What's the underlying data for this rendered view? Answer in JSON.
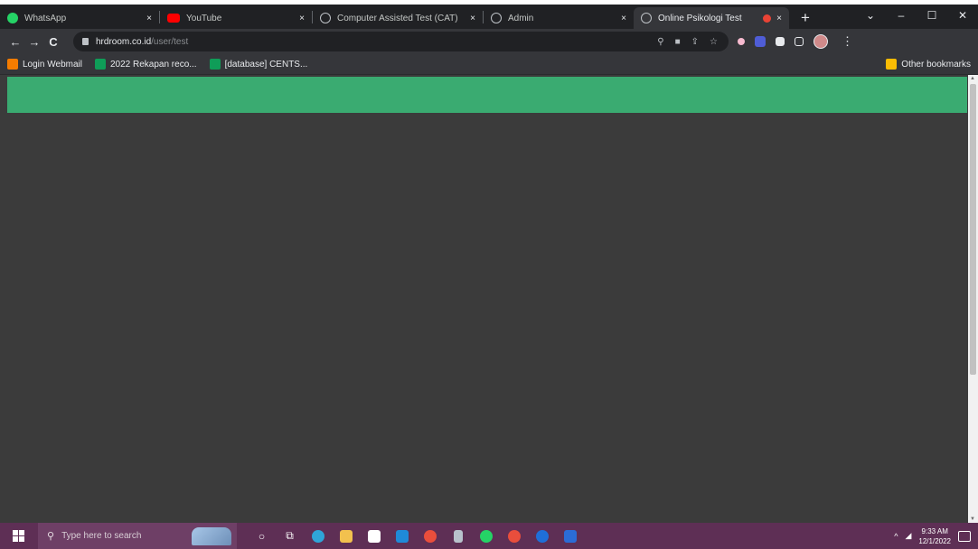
{
  "browser": {
    "tabs": [
      {
        "title": "WhatsApp",
        "close": "×",
        "favicon": "whatsapp-icon",
        "active": false
      },
      {
        "title": "YouTube",
        "close": "×",
        "favicon": "youtube-icon",
        "active": false
      },
      {
        "title": "Computer Assisted Test (CAT)",
        "close": "×",
        "favicon": "globe-icon",
        "active": false
      },
      {
        "title": "Admin",
        "close": "×",
        "favicon": "globe-icon",
        "active": false
      },
      {
        "title": "Online Psikologi Test",
        "close": "×",
        "favicon": "globe-icon",
        "active": true
      }
    ],
    "new_tab": "+",
    "window": {
      "dropdown": "⌄",
      "minimize": "–",
      "maximize": "☐",
      "close": "✕"
    },
    "nav": {
      "back": "←",
      "forward": "→",
      "reload": "C"
    },
    "url_host": "hrdroom.co.id",
    "url_path": "/user/test",
    "bookmarks": [
      {
        "label": "Login Webmail",
        "color": "#f57c00"
      },
      {
        "label": "2022 Rekapan reco...",
        "color": "#0f9d58"
      },
      {
        "label": "[database] CENTS...",
        "color": "#0f9d58"
      }
    ],
    "other_bookmarks": "Other bookmarks",
    "colors": {
      "accent_header": "#3aab71",
      "page_bg": "#3b3b3b",
      "taskbar": "#5e2f55"
    }
  },
  "taskbar": {
    "search_placeholder": "Type here to search",
    "time": "9:33 AM",
    "date": "12/1/2022",
    "tray_chevron": "^",
    "apps": [
      {
        "icon": "cortana-icon",
        "glyph": "○"
      },
      {
        "icon": "task-view-icon",
        "glyph": "⧉"
      },
      {
        "icon": "edge-icon",
        "color": "#2fa4d8"
      },
      {
        "icon": "file-explorer-icon",
        "color": "#f2c14e"
      },
      {
        "icon": "store-icon",
        "color": "#ffffff"
      },
      {
        "icon": "mail-icon",
        "color": "#1f8ad8"
      },
      {
        "icon": "chrome-icon",
        "color": "#e94e3c"
      },
      {
        "icon": "document-icon",
        "color": "#b8c2cc"
      },
      {
        "icon": "whatsapp-icon",
        "color": "#25d366"
      },
      {
        "icon": "chrome-alt-icon",
        "color": "#e94e3c"
      },
      {
        "icon": "outlook-icon",
        "color": "#1f6fd8"
      },
      {
        "icon": "word-icon",
        "color": "#2b6cd6"
      }
    ]
  }
}
